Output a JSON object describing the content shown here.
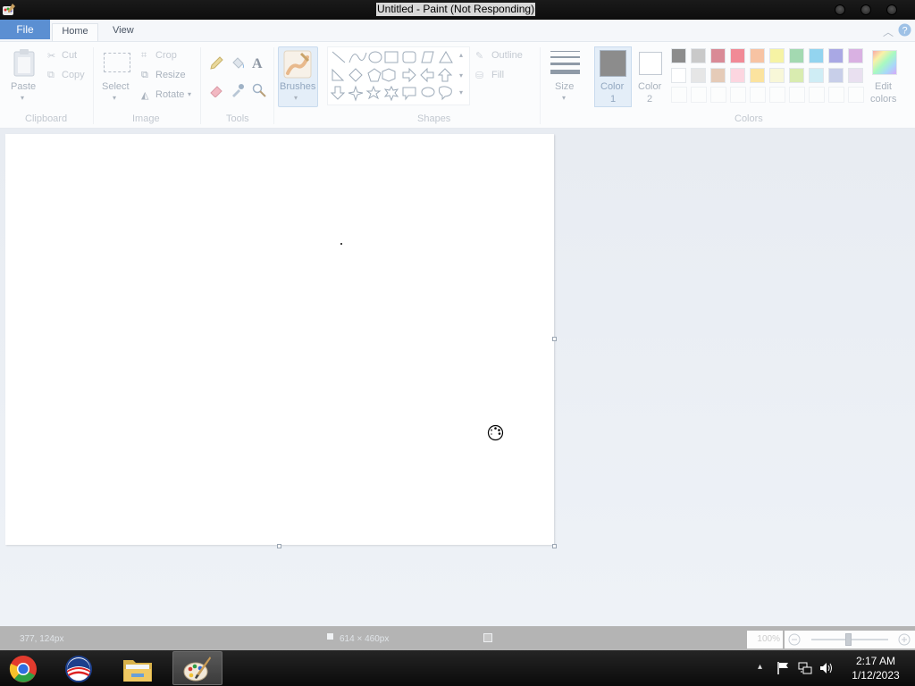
{
  "window": {
    "title": "Untitled - Paint (Not Responding)"
  },
  "tabs": {
    "file": "File",
    "home": "Home",
    "view": "View"
  },
  "ribbon": {
    "clipboard": {
      "paste": "Paste",
      "cut": "Cut",
      "copy": "Copy",
      "group": "Clipboard"
    },
    "image": {
      "select": "Select",
      "crop": "Crop",
      "resize": "Resize",
      "rotate": "Rotate",
      "group": "Image"
    },
    "tools": {
      "group": "Tools"
    },
    "brushes": {
      "label": "Brushes"
    },
    "shapes": {
      "outline": "Outline",
      "fill": "Fill",
      "group": "Shapes"
    },
    "size": {
      "label": "Size"
    },
    "color1": {
      "label": "Color",
      "num": "1"
    },
    "color2": {
      "label": "Color",
      "num": "2"
    },
    "colors": {
      "group": "Colors",
      "edit_line1": "Edit",
      "edit_line2": "colors",
      "row1": [
        "#8c8c8c",
        "#c9c9c9",
        "#d98a96",
        "#f18a96",
        "#f7c3a3",
        "#f6f3a4",
        "#a3d9b1",
        "#93d4ef",
        "#a9a8e4",
        "#d9b1e2"
      ],
      "row2": [
        "#ffffff",
        "#e6e6e6",
        "#e5cbb8",
        "#fcd6e0",
        "#fbe39f",
        "#f8f7d8",
        "#d9ecb0",
        "#cfedf5",
        "#c8cfe9",
        "#e9e0f0"
      ]
    }
  },
  "status": {
    "cursor_pos": "377, 124px",
    "canvas_size": "614 × 460px",
    "zoom": "100%"
  },
  "taskbar": {
    "time": "2:17 AM",
    "date": "1/12/2023"
  }
}
